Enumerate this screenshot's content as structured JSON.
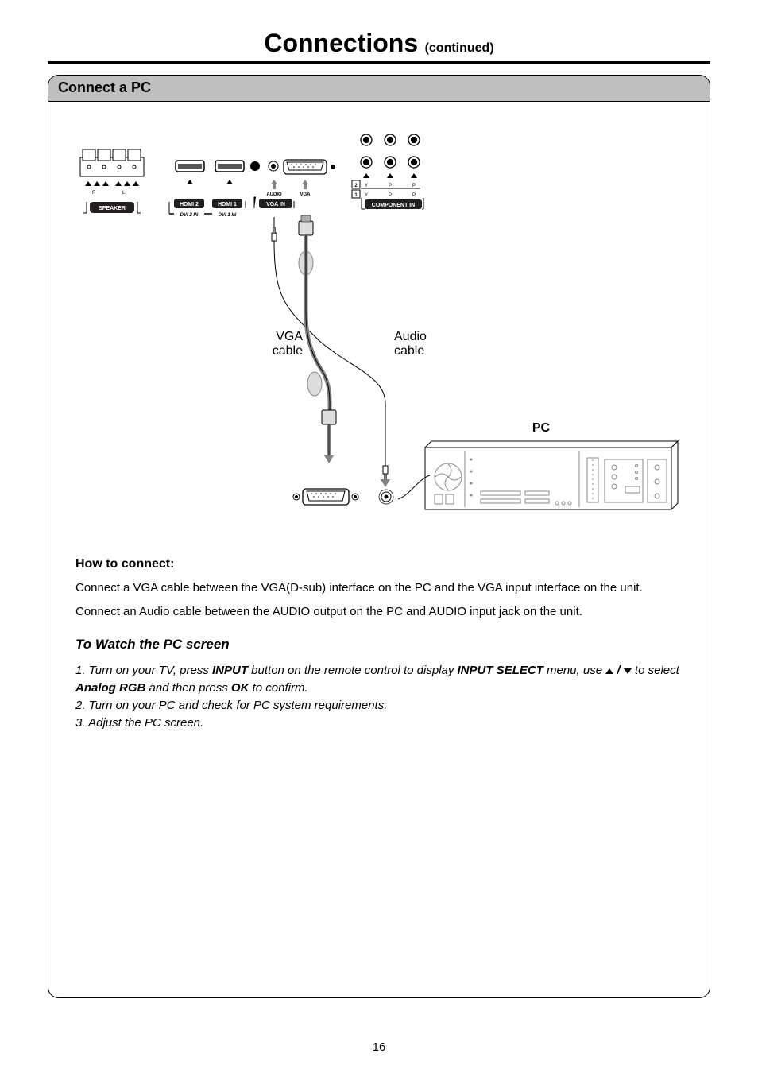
{
  "title": {
    "main": "Connections",
    "continued": "(continued)"
  },
  "section": {
    "header": "Connect a PC"
  },
  "diagram": {
    "speaker_label": "SPEAKER",
    "hdmi2": "HDMI 2",
    "hdmi1": "HDMI 1",
    "dvi2": "DVI 2 IN",
    "dvi1": "DVI 1 IN",
    "audio_label": "AUDIO",
    "vga_label_top": "VGA",
    "vga_in": "VGA IN",
    "component_in": "COMPONENT IN",
    "comp_y": "Y",
    "comp_pb": "P",
    "comp_pr": "P",
    "comp_row1": "1",
    "comp_row2": "2",
    "vga_cable": "VGA",
    "vga_cable2": "cable",
    "audio_cable": "Audio",
    "audio_cable2": "cable",
    "pc_label": "PC",
    "rca_r": "R",
    "rca_l": "L"
  },
  "how": {
    "heading": "How to connect:",
    "line1": "Connect a VGA cable between the VGA(D-sub) interface on the PC and the VGA input interface on the unit.",
    "line2": "Connect an Audio cable between  the AUDIO output on the PC and AUDIO input jack on the unit."
  },
  "watch": {
    "heading": "To Watch the PC screen",
    "step1a": "1. Turn on your TV, press ",
    "step1_input": "INPUT",
    "step1b": " button on the remote control to display ",
    "step1_inputselect": "INPUT SELECT",
    "step1c": " menu, use ",
    "step1d": " to select ",
    "step1_analog": "Analog RGB",
    "step1e": " and then press ",
    "step1_ok": "OK",
    "step1f": " to confirm.",
    "step2": "2. Turn on your PC and check for PC system requirements.",
    "step3": "3. Adjust the PC screen."
  },
  "page_number": "16"
}
